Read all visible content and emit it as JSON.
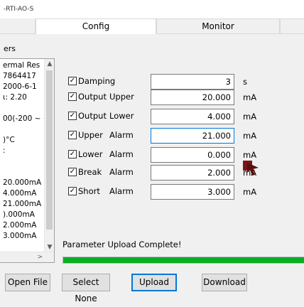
{
  "window": {
    "title": "-RTI-AO-S"
  },
  "tabs": [
    {
      "label": ""
    },
    {
      "label": "Config"
    },
    {
      "label": "Monitor"
    },
    {
      "label": ""
    }
  ],
  "sidebar": {
    "section_label": "ers",
    "items": [
      "ermal Res",
      "7864417",
      "2000-6-1",
      "ι: 2.20",
      "",
      "00(-200 ~ +",
      "",
      ")°C",
      ":",
      "",
      "",
      "20.000mA",
      "4.000mA",
      "21.000mA",
      ").000mA",
      "2.000mA",
      "3.000mA"
    ]
  },
  "params": [
    {
      "checked": true,
      "label": "Damping",
      "sub": "",
      "value": "3",
      "unit": "s",
      "focused": false
    },
    {
      "checked": true,
      "label": "Output",
      "sub": "Upper",
      "value": "20.000",
      "unit": "mA",
      "focused": false
    },
    {
      "checked": true,
      "label": "Output",
      "sub": "Lower",
      "value": "4.000",
      "unit": "mA",
      "focused": false
    },
    {
      "checked": true,
      "label": "Upper",
      "sub": "Alarm",
      "value": "21.000",
      "unit": "mA",
      "focused": true
    },
    {
      "checked": true,
      "label": "Lower",
      "sub": "Alarm",
      "value": "0.000",
      "unit": "mA",
      "focused": false
    },
    {
      "checked": true,
      "label": "Break",
      "sub": "Alarm",
      "value": "2.000",
      "unit": "mA",
      "focused": false
    },
    {
      "checked": true,
      "label": "Short",
      "sub": "Alarm",
      "value": "3.000",
      "unit": "mA",
      "focused": false
    }
  ],
  "status": {
    "text": "Parameter Upload Complete!",
    "progress_percent": 100,
    "progress_color": "#06b025"
  },
  "buttons": {
    "open_file": "Open File",
    "select_none": "Select None",
    "upload": "Upload",
    "download": "Download"
  }
}
